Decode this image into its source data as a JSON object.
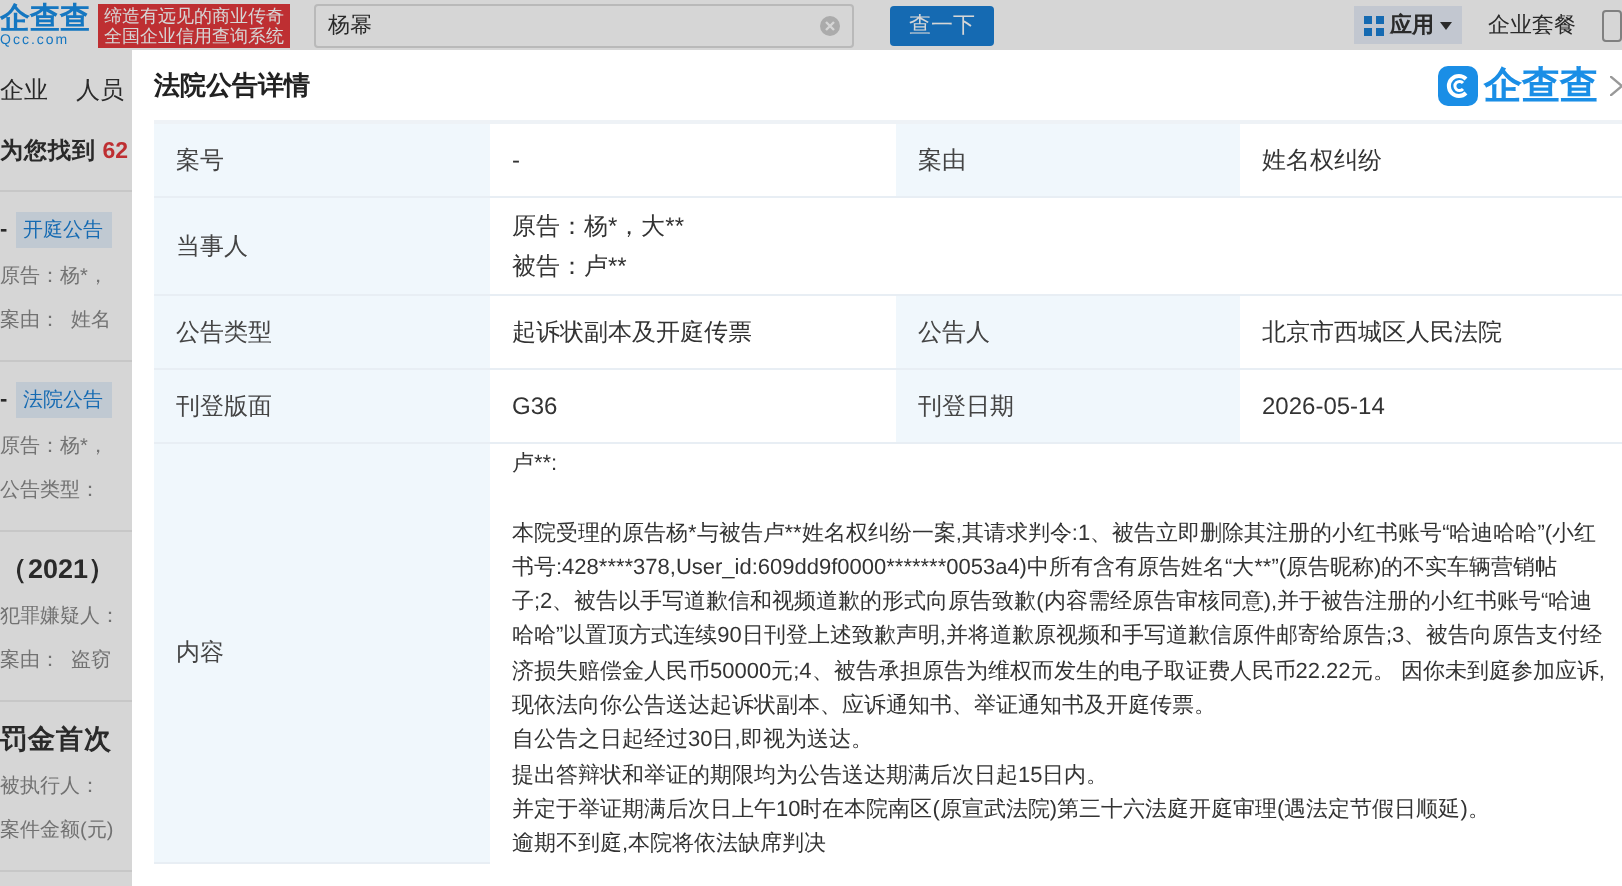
{
  "header": {
    "logo": "企查查",
    "logo_domain": "Qcc.com",
    "slogan": [
      "缔造有远见的商业传奇",
      "全国企业信用查询系统"
    ],
    "search": {
      "value": "杨幂"
    },
    "search_button": "查一下",
    "menu": [
      {
        "label": "应用",
        "kind": "apps"
      },
      {
        "label": "企业套餐",
        "kind": "plain"
      }
    ]
  },
  "nav": [
    "企业",
    "人员"
  ],
  "results": {
    "summary": "为您找到",
    "count": "62",
    "items": [
      {
        "kind": "tagged",
        "prefix": "-",
        "tag": "开庭公告",
        "lines": [
          "原告：杨*，",
          "案由：  姓名"
        ]
      },
      {
        "kind": "tagged",
        "prefix": "-",
        "tag": "法院公告",
        "lines": [
          "原告：杨*，",
          "公告类型："
        ]
      },
      {
        "kind": "titled",
        "title": "（2021）",
        "lines": [
          "犯罪嫌疑人：",
          "案由：  盗窃"
        ]
      },
      {
        "kind": "titled",
        "title": "罚金首次",
        "lines": [
          "被执行人：",
          "案件金额(元)"
        ]
      }
    ]
  },
  "modal": {
    "title": "法院公告详情",
    "brand": "企查查",
    "rows": [
      {
        "kind": "pair",
        "label": "案号",
        "value": "-",
        "label2": "案由",
        "value2": "姓名权纠纷"
      },
      {
        "kind": "lines",
        "label": "当事人",
        "lines": [
          "原告：杨*，大**",
          "被告：卢**"
        ]
      },
      {
        "kind": "pair",
        "label": "公告类型",
        "value": "起诉状副本及开庭传票",
        "label2": "公告人",
        "value2": "北京市西城区人民法院"
      },
      {
        "kind": "pair",
        "label": "刊登版面",
        "value": "G36",
        "label2": "刊登日期",
        "value2": "2026-05-14"
      },
      {
        "kind": "content",
        "label": "内容",
        "greeting": "卢**:",
        "paragraphs": [
          "本院受理的原告杨*与被告卢**姓名权纠纷一案,其请求判令:1、被告立即删除其注册的小红书账号“哈迪哈哈”(小红书号:428****378,User_id:609dd9f0000*******0053a4)中所有含有原告姓名“大**”(原告昵称)的不实车辆营销帖子;2、被告以手写道歉信和视频道歉的形式向原告致歉(内容需经原告审核同意),并于被告注册的小红书账号“哈迪哈哈”以置顶方式连续90日刊登上述致歉声明,并将道歉原视频和手写道歉信原件邮寄给原告;3、被告向原告支付经济损失赔偿金人民币50000元;4、被告承担原告为维权而发生的电子取证费人民币22.22元。 因你未到庭参加应诉,现依法向你公告送达起诉状副本、应诉通知书、举证通知书及开庭传票。",
          "自公告之日起经过30日,即视为送达。",
          "提出答辩状和举证的期限均为公告送达期满后次日起15日内。",
          "并定于举证期满后次日上午10时在本院南区(原宣武法院)第三十六法庭开庭审理(遇法定节假日顺延)。",
          "逾期不到庭,本院将依法缺席判决"
        ]
      }
    ]
  }
}
